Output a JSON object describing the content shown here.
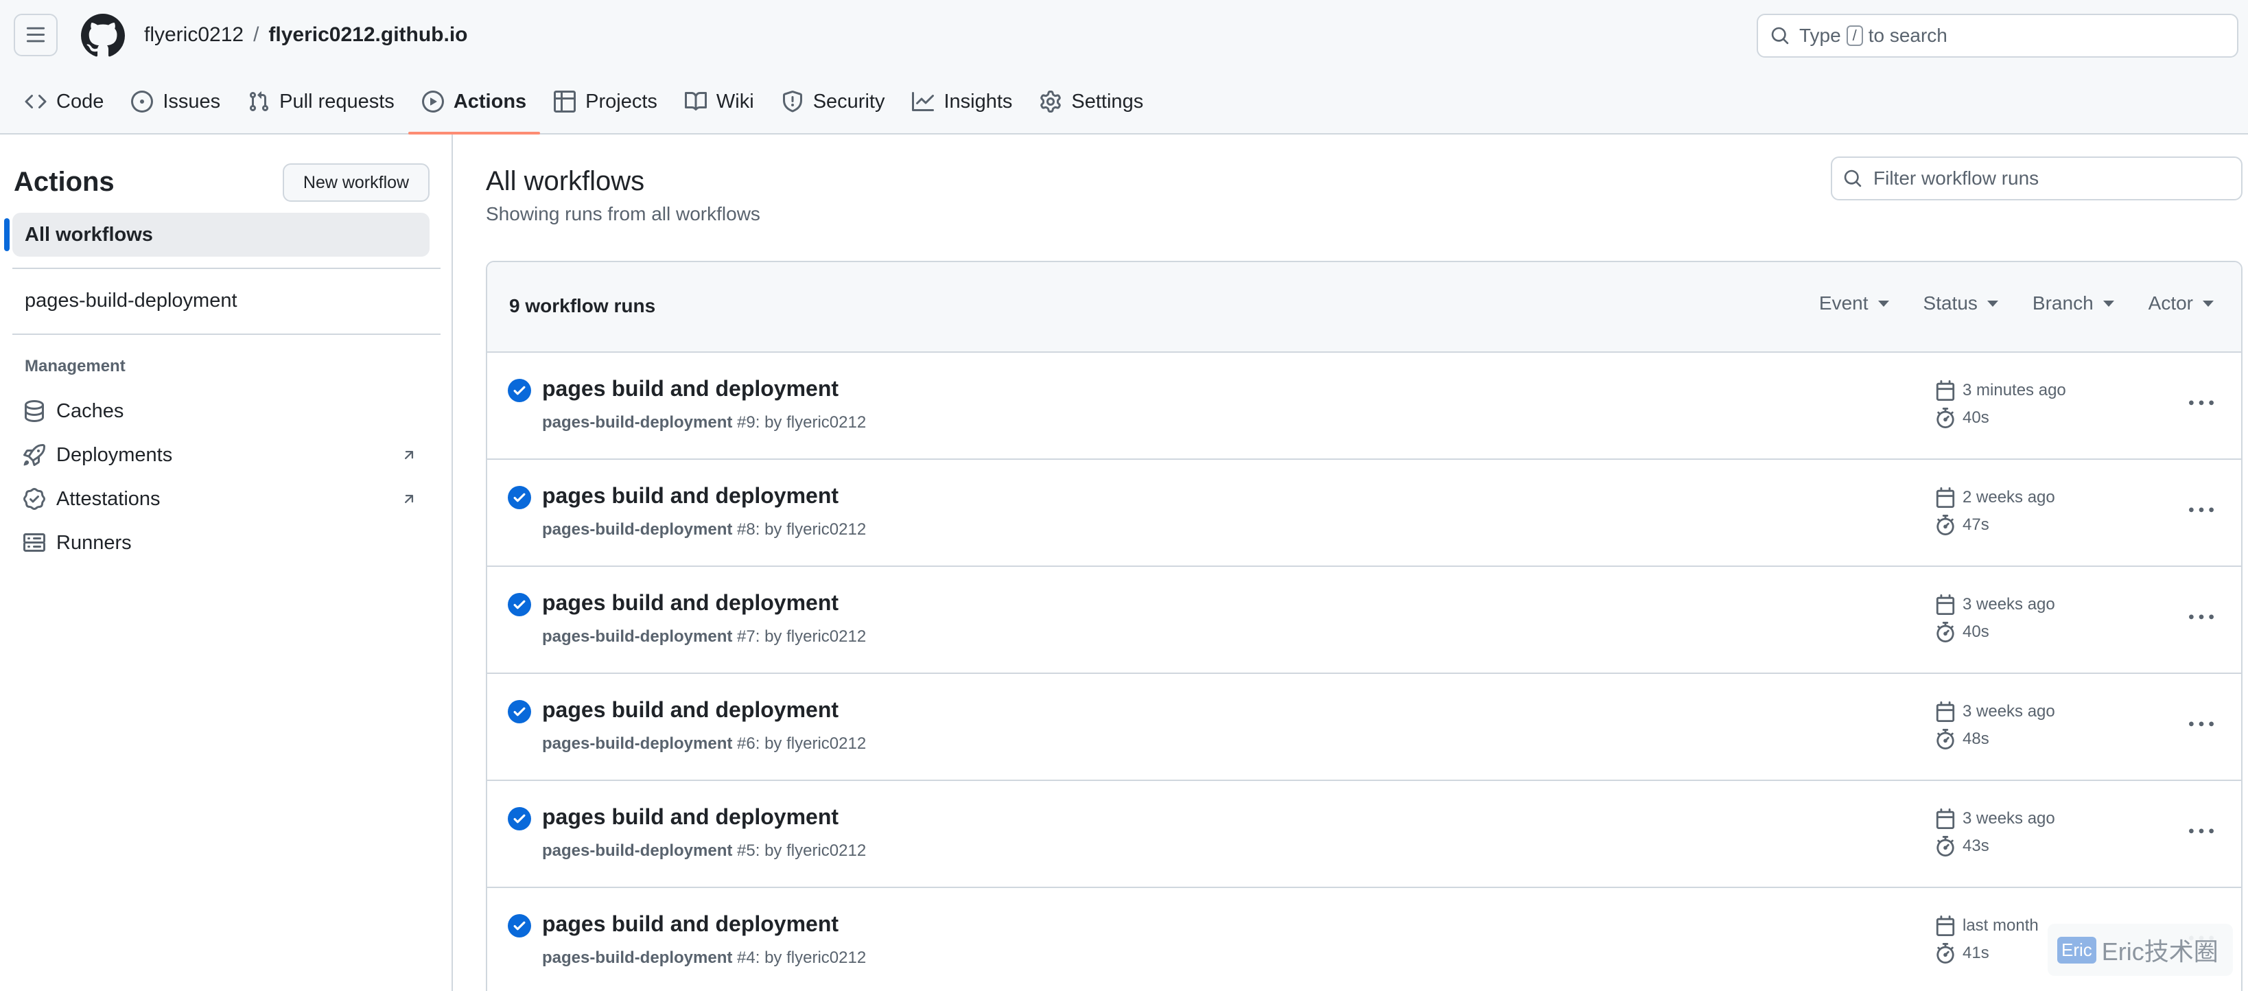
{
  "header": {
    "owner": "flyeric0212",
    "separator": "/",
    "repo": "flyeric0212.github.io",
    "search": {
      "prefix": "Type",
      "key": "/",
      "suffix": "to search"
    }
  },
  "nav": {
    "tabs": [
      {
        "label": "Code",
        "icon": "code-icon"
      },
      {
        "label": "Issues",
        "icon": "issue-opened-icon"
      },
      {
        "label": "Pull requests",
        "icon": "git-pull-request-icon"
      },
      {
        "label": "Actions",
        "icon": "play-icon",
        "selected": true
      },
      {
        "label": "Projects",
        "icon": "table-icon"
      },
      {
        "label": "Wiki",
        "icon": "book-icon"
      },
      {
        "label": "Security",
        "icon": "shield-icon"
      },
      {
        "label": "Insights",
        "icon": "graph-icon"
      },
      {
        "label": "Settings",
        "icon": "gear-icon"
      }
    ]
  },
  "sidebar": {
    "title": "Actions",
    "new_workflow": "New workflow",
    "all_workflows": "All workflows",
    "workflows": [
      "pages-build-deployment"
    ],
    "management_heading": "Management",
    "management": [
      {
        "label": "Caches",
        "icon": "database-icon",
        "external": false
      },
      {
        "label": "Deployments",
        "icon": "rocket-icon",
        "external": true
      },
      {
        "label": "Attestations",
        "icon": "verified-icon",
        "external": true
      },
      {
        "label": "Runners",
        "icon": "server-icon",
        "external": false
      }
    ]
  },
  "main": {
    "title": "All workflows",
    "subtitle": "Showing runs from all workflows",
    "filter_placeholder": "Filter workflow runs",
    "runs_count": "9 workflow runs",
    "filters": [
      "Event",
      "Status",
      "Branch",
      "Actor"
    ],
    "runs": [
      {
        "title": "pages build and deployment",
        "workflow": "pages-build-deployment",
        "number": "#9",
        "actor": "flyeric0212",
        "when": "3 minutes ago",
        "duration": "40s",
        "status": "success"
      },
      {
        "title": "pages build and deployment",
        "workflow": "pages-build-deployment",
        "number": "#8",
        "actor": "flyeric0212",
        "when": "2 weeks ago",
        "duration": "47s",
        "status": "success"
      },
      {
        "title": "pages build and deployment",
        "workflow": "pages-build-deployment",
        "number": "#7",
        "actor": "flyeric0212",
        "when": "3 weeks ago",
        "duration": "40s",
        "status": "success"
      },
      {
        "title": "pages build and deployment",
        "workflow": "pages-build-deployment",
        "number": "#6",
        "actor": "flyeric0212",
        "when": "3 weeks ago",
        "duration": "48s",
        "status": "success"
      },
      {
        "title": "pages build and deployment",
        "workflow": "pages-build-deployment",
        "number": "#5",
        "actor": "flyeric0212",
        "when": "3 weeks ago",
        "duration": "43s",
        "status": "success"
      },
      {
        "title": "pages build and deployment",
        "workflow": "pages-build-deployment",
        "number": "#4",
        "actor": "flyeric0212",
        "when": "last month",
        "duration": "41s",
        "status": "success"
      }
    ],
    "run_meta_by": "by"
  },
  "watermark": {
    "badge": "Eric",
    "text": "Eric技术圈"
  },
  "colors": {
    "accent": "#0969da",
    "selected_underline": "#fd8c73",
    "success": "#0969da",
    "border": "#d0d7de",
    "muted": "#59636e"
  }
}
